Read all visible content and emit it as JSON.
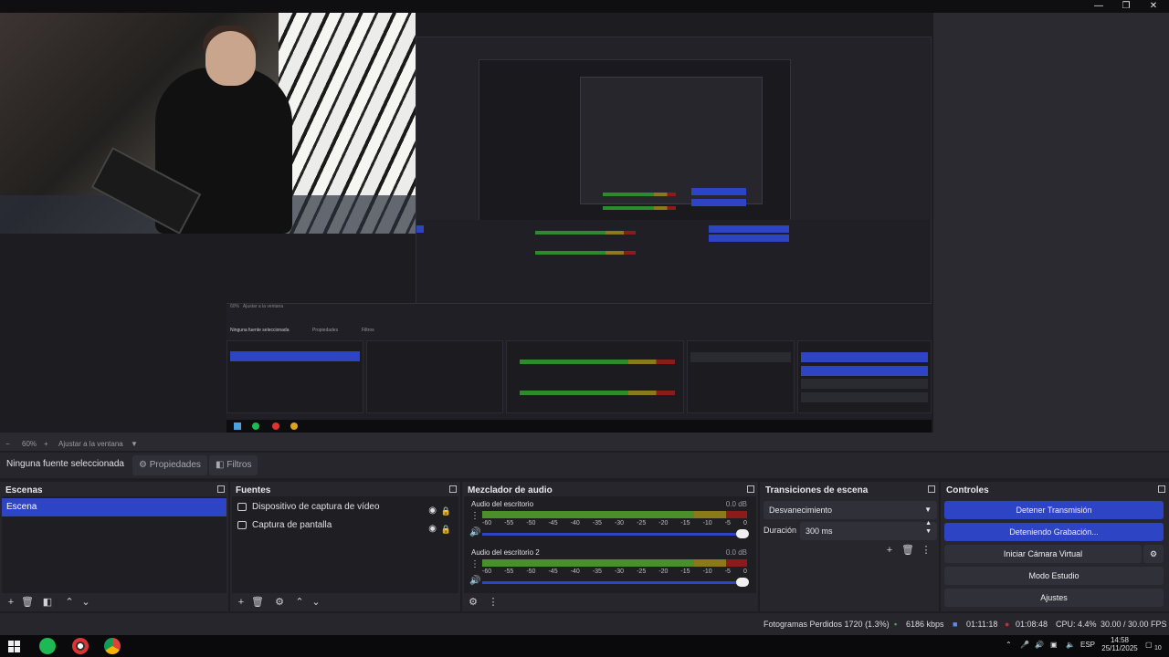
{
  "preview": {
    "zoom": "60%",
    "fit_label": "Ajustar a la ventana",
    "nested_zoom": "60%",
    "nested_fit_label": "Ajustar a la ventana",
    "nested_no_source": "Ninguna fuente seleccionada",
    "nested_props": "Propiedades",
    "nested_filters": "Filtros"
  },
  "propbar": {
    "no_source": "Ninguna fuente seleccionada",
    "properties": "Propiedades",
    "filters": "Filtros"
  },
  "scenes": {
    "title": "Escenas",
    "items": [
      {
        "label": "Escena"
      }
    ]
  },
  "sources": {
    "title": "Fuentes",
    "items": [
      {
        "label": "Dispositivo de captura de vídeo",
        "icon": "camera-icon"
      },
      {
        "label": "Captura de pantalla",
        "icon": "monitor-icon"
      }
    ]
  },
  "mixer": {
    "title": "Mezclador de audio",
    "ticks": [
      "-60",
      "-55",
      "-50",
      "-45",
      "-40",
      "-35",
      "-30",
      "-25",
      "-20",
      "-15",
      "-10",
      "-5",
      "0"
    ],
    "tracks": [
      {
        "name": "Audio del escritorio",
        "db": "0.0 dB"
      },
      {
        "name": "Audio del escritorio 2",
        "db": "0.0 dB"
      }
    ]
  },
  "transitions": {
    "title": "Transiciones de escena",
    "selected": "Desvanecimiento",
    "duration_label": "Duración",
    "duration_value": "300 ms"
  },
  "controls": {
    "title": "Controles",
    "stop_stream": "Detener Transmisión",
    "stopping_recording": "Deteniendo Grabación...",
    "start_virtual_cam": "Iniciar Cámara Virtual",
    "studio_mode": "Modo Estudio",
    "settings": "Ajustes"
  },
  "status": {
    "dropped_frames": "Fotogramas Perdidos 1720 (1.3%)",
    "bitrate": "6186 kbps",
    "stream_time": "01:11:18",
    "record_time": "01:08:48",
    "cpu": "CPU: 4.4%",
    "fps": "30.00 / 30.00 FPS"
  },
  "taskbar": {
    "lang": "ESP",
    "time": "14:58",
    "date": "25/11/2025",
    "notifications": "10"
  },
  "colors": {
    "accent": "#2d45c5",
    "panel": "#26262c",
    "record_red": "#d62828",
    "meter_green": "#4b8f2a"
  }
}
